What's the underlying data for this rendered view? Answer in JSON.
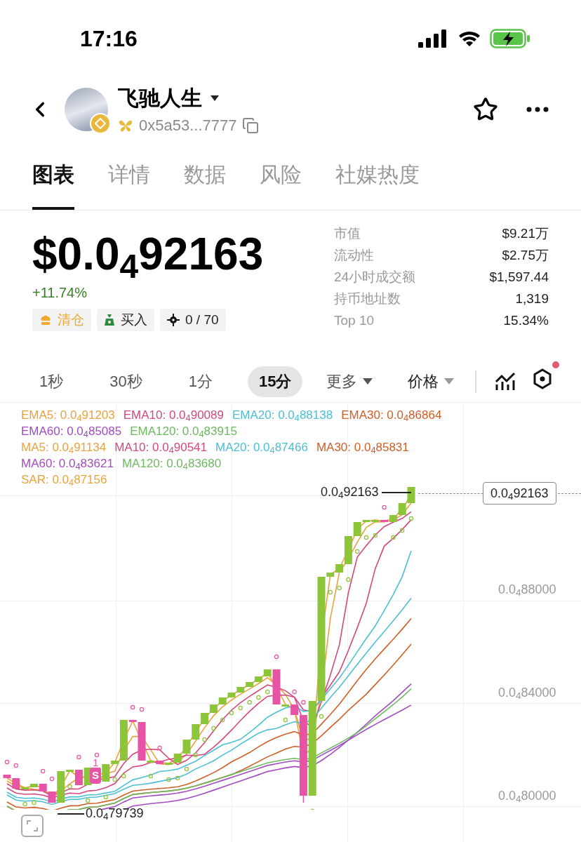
{
  "status_bar": {
    "time": "17:16"
  },
  "header": {
    "name": "飞驰人生",
    "address": "0x5a53...7777"
  },
  "tabs": [
    {
      "label": "图表",
      "selected": true
    },
    {
      "label": "详情",
      "selected": false
    },
    {
      "label": "数据",
      "selected": false
    },
    {
      "label": "风险",
      "selected": false
    },
    {
      "label": "社媒热度",
      "selected": false
    }
  ],
  "price": {
    "value": "$0.0$_{4}$92163",
    "change": "+11.74%"
  },
  "tags": [
    {
      "kind": "clear",
      "label": "清仓"
    },
    {
      "kind": "buy",
      "label": "买入"
    },
    {
      "kind": "target",
      "label": "0 / 70"
    }
  ],
  "stats": [
    {
      "label": "市值",
      "value": "$9.21万"
    },
    {
      "label": "流动性",
      "value": "$2.75万"
    },
    {
      "label": "24小时成交额",
      "value": "$1,597.44"
    },
    {
      "label": "持币地址数",
      "value": "1,319"
    },
    {
      "label": "Top 10",
      "value": "15.34%"
    }
  ],
  "timeframes": [
    {
      "label": "1秒",
      "selected": false
    },
    {
      "label": "30秒",
      "selected": false
    },
    {
      "label": "1分",
      "selected": false
    },
    {
      "label": "15分",
      "selected": true
    }
  ],
  "dropdowns": [
    "更多",
    "价格"
  ],
  "indicator_groups": [
    [
      {
        "text": "EMA5: 0.0$_{4}$91203",
        "color": "#eaa23f"
      },
      {
        "text": "EMA10: 0.0$_{4}$90089",
        "color": "#d6477d"
      },
      {
        "text": "EMA20: 0.0$_{4}$88138",
        "color": "#4cbfd4"
      },
      {
        "text": "EMA30: 0.0$_{4}$86864",
        "color": "#cf5f26"
      },
      {
        "text": "EMA60: 0.0$_{4}$85085",
        "color": "#a24bc0"
      },
      {
        "text": "EMA120: 0.0$_{4}$83915",
        "color": "#6fb862"
      }
    ],
    [
      {
        "text": "MA5: 0.0$_{4}$91134",
        "color": "#eaa23f"
      },
      {
        "text": "MA10: 0.0$_{4}$90541",
        "color": "#d6477d"
      },
      {
        "text": "MA20: 0.0$_{4}$87466",
        "color": "#4cbfd4"
      },
      {
        "text": "MA30: 0.0$_{4}$85831",
        "color": "#cf5f26"
      },
      {
        "text": "MA60: 0.0$_{4}$83621",
        "color": "#a24bc0"
      },
      {
        "text": "MA120: 0.0$_{4}$83680",
        "color": "#6fb862"
      }
    ],
    [
      {
        "text": "SAR: 0.0$_{4}$87156",
        "color": "#eaa23f"
      }
    ]
  ],
  "chart": {
    "high_label": "0.0$_{4}$92163",
    "current_price": "0.0$_{4}$92163",
    "low_label": "0.0$_{4}$79739",
    "y_labels": [
      "0.0$_{4}$88000",
      "0.0$_{4}$84000",
      "0.0$_{4}$80000"
    ],
    "trade_markers": [
      "1",
      "S"
    ]
  }
}
